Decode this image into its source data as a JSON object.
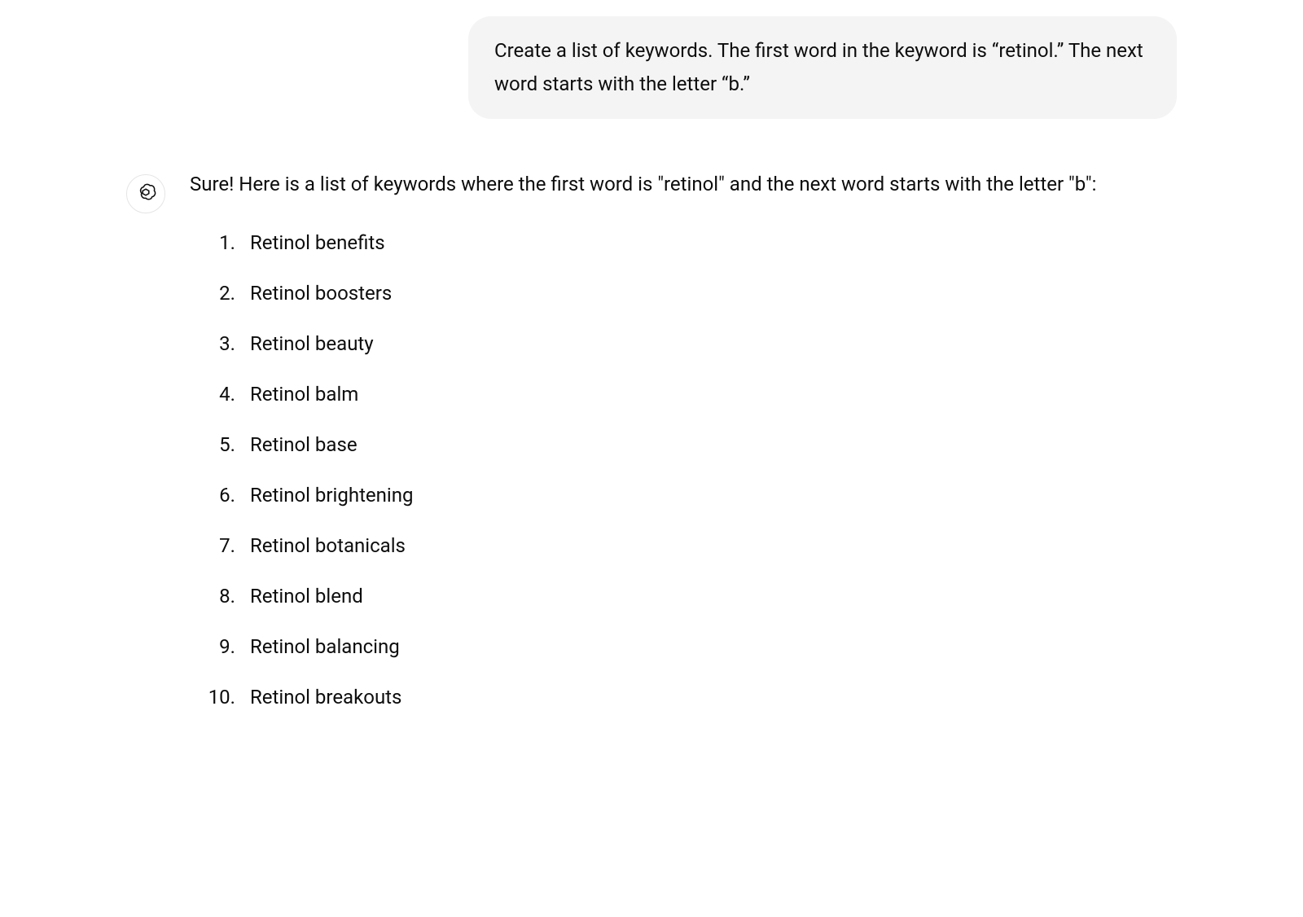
{
  "user_message": "Create a list of keywords. The first word in the keyword is “retinol.” The next word starts with the letter “b.”",
  "assistant": {
    "intro": "Sure! Here is a list of keywords where the first word is \"retinol\" and the next word starts with the letter \"b\":",
    "items": [
      "Retinol benefits",
      "Retinol boosters",
      "Retinol beauty",
      "Retinol balm",
      "Retinol base",
      "Retinol brightening",
      "Retinol botanicals",
      "Retinol blend",
      "Retinol balancing",
      "Retinol breakouts"
    ]
  }
}
